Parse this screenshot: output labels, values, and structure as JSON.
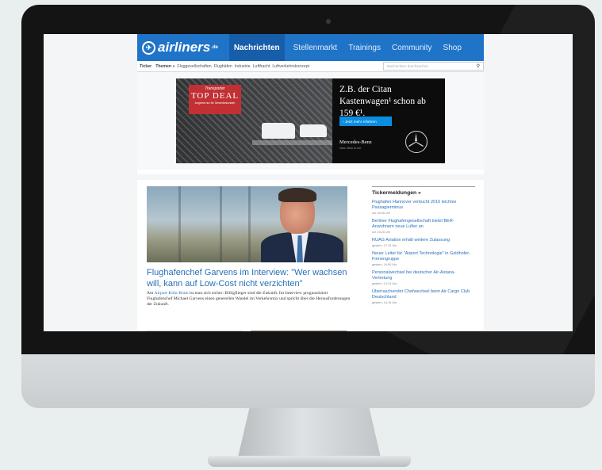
{
  "nav": {
    "logo": "airliners",
    "logo_sup": ".de",
    "items": [
      "Nachrichten",
      "Stellenmarkt",
      "Trainings",
      "Community",
      "Shop"
    ]
  },
  "subnav": {
    "ticker": "Ticker",
    "themes": "Themen »",
    "items": [
      "Fluggesellschaften",
      "Flughäfen",
      "Industrie",
      "Luftfracht",
      "Luftverkehrskonzept"
    ],
    "search_placeholder": "Nachrichten durchsuchen"
  },
  "ad": {
    "kicker": "Transporter",
    "deal": "TOP DEAL",
    "small": "Angebot nur für Gewerbekunden",
    "headline": "Z.B. der Citan Kastenwagen¹ schon ab 159 €¹.",
    "button": "› Jetzt mehr erfahren",
    "brand": "Mercedes-Benz",
    "brand_sub": "Vans. Born to run."
  },
  "article": {
    "headline": "Flughafenchef Garvens im Interview: \"Wer wachsen will, kann auf Low-Cost nicht verzichten\"",
    "teaser_pre": "Am ",
    "teaser_link": "Airport Köln-Bonn",
    "teaser_post": " ist man sich sicher: Billigflieger sind die Zukunft. Im Interview prognostiziert Flughafenchef Michael Garvens einen generellen Wandel im Verkehrsmix und spricht über die Herausforderungen der Zukunft."
  },
  "sidebar": {
    "title": "Tickermeldungen »",
    "items": [
      {
        "text": "Flughafen Hannover verbucht 2016 leichtes Passagierminus",
        "time": "um 16:05 Uhr"
      },
      {
        "text": "Berliner Flughafengesellschaft bietet BER-Anwohnern neue Lüfter an",
        "time": "um 15:20 Uhr"
      },
      {
        "text": "RUAG Aviation erhält weitere Zulassung",
        "time": "gestern, 17:15 Uhr"
      },
      {
        "text": "Neuer Leiter für \"Airport Technologie\" in Goldhofer-Firmengruppe",
        "time": "gestern, 14:50 Uhr"
      },
      {
        "text": "Personalwechsel bei deutscher Air-Astana-Vertretung",
        "time": "gestern, 13:10 Uhr"
      },
      {
        "text": "Überraschender Chefwechsel beim Air Cargo Club Deutschland",
        "time": "gestern, 14:15 Uhr"
      }
    ]
  }
}
